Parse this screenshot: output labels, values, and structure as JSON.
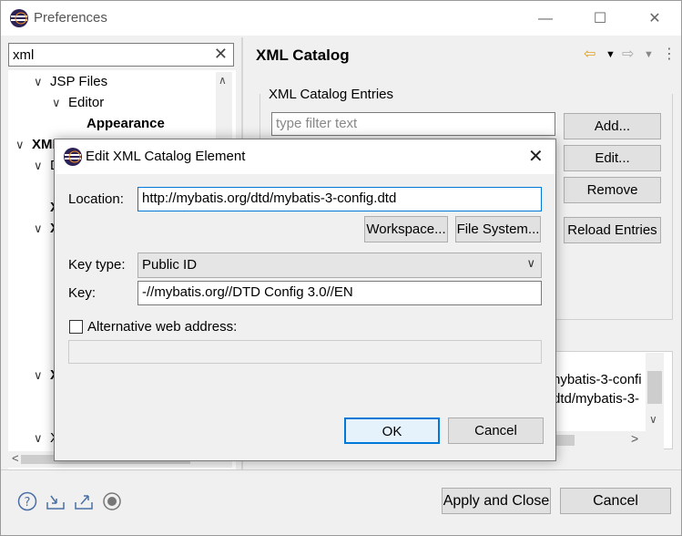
{
  "window": {
    "title": "Preferences",
    "minimize": "—",
    "maximize": "☐",
    "close": "✕"
  },
  "filter": {
    "value": "xml",
    "clear": "✕"
  },
  "tree": {
    "items": [
      {
        "label": "JSP Files",
        "expanded": true
      },
      {
        "label": "Editor",
        "expanded": true
      },
      {
        "label": "Appearance",
        "selected": true
      },
      {
        "label": "XML",
        "expanded": true
      },
      {
        "label": "D"
      },
      {
        "label": "X"
      },
      {
        "label": "X"
      },
      {
        "label": "X"
      },
      {
        "label": "X"
      }
    ]
  },
  "page": {
    "title": "XML Catalog",
    "group_label": "XML Catalog Entries",
    "filter_placeholder": "type filter text",
    "buttons": {
      "add": "Add...",
      "edit": "Edit...",
      "remove": "Remove",
      "reload": "Reload Entries"
    },
    "details_line1": "nybatis-3-confi",
    "details_line2": "dtd/mybatis-3-"
  },
  "bottom": {
    "apply_close": "Apply and Close",
    "cancel": "Cancel"
  },
  "dialog": {
    "title": "Edit XML Catalog Element",
    "close": "✕",
    "location_label": "Location:",
    "location_value": "http://mybatis.org/dtd/mybatis-3-config.dtd",
    "workspace_button": "Workspace...",
    "filesystem_button": "File System...",
    "key_type_label": "Key type:",
    "key_type_value": "Public ID",
    "key_label": "Key:",
    "key_value": "-//mybatis.org//DTD Config 3.0//EN",
    "alt_label": "Alternative web address:",
    "alt_checked": false,
    "ok": "OK",
    "cancel": "Cancel"
  },
  "colors": {
    "accent": "#0078d7",
    "window_bg": "#f0f0f0",
    "back_arrow": "#e0a020"
  }
}
